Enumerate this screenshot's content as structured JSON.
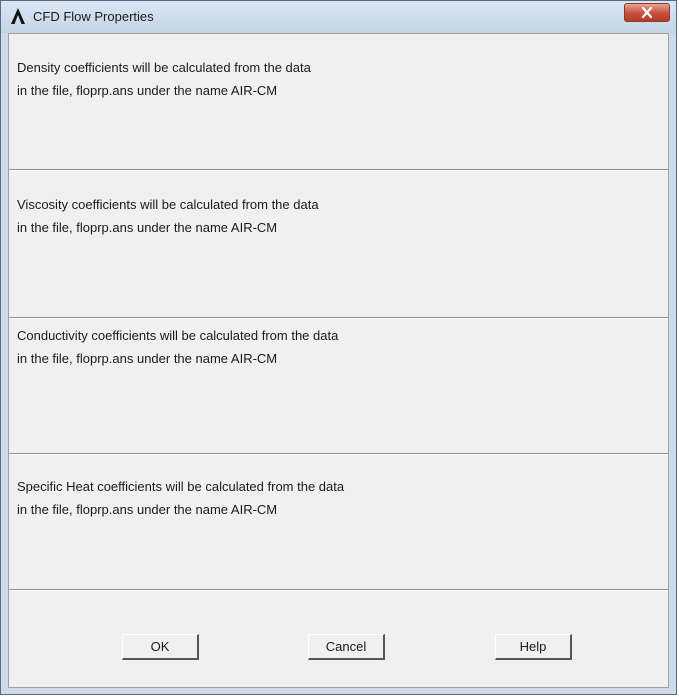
{
  "window": {
    "title": "CFD Flow Properties",
    "app_icon": "ansys-logo-icon",
    "close_icon": "close-icon"
  },
  "panels": [
    {
      "line1": "Density coefficients will be calculated from the data",
      "line2": "in the file, floprp.ans under the name  AIR-CM"
    },
    {
      "line1": "Viscosity coefficients will be calculated from the data",
      "line2": "in the file, floprp.ans under the name  AIR-CM"
    },
    {
      "line1": "Conductivity coefficients will be calculated from the data",
      "line2": "in the file, floprp.ans under the name  AIR-CM"
    },
    {
      "line1": "Specific Heat coefficients will be calculated from the data",
      "line2": "in the file, floprp.ans under the name  AIR-CM"
    }
  ],
  "buttons": {
    "ok": "OK",
    "cancel": "Cancel",
    "help": "Help"
  }
}
